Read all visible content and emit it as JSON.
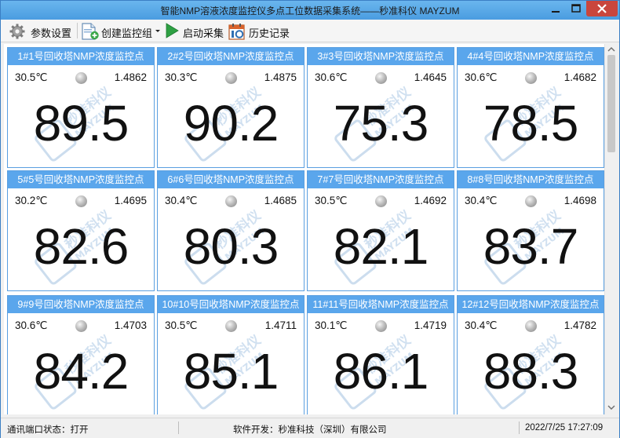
{
  "window": {
    "title": "智能NMP溶液浓度监控仪多点工位数据采集系统——秒准科仪 MAYZUM"
  },
  "toolbar": {
    "settings_label": "参数设置",
    "create_group_label": "创建监控组",
    "start_label": "启动采集",
    "history_label": "历史记录"
  },
  "watermark": {
    "brand_cn": "秒准科仪",
    "brand_en": "MAYZUM"
  },
  "cards": [
    {
      "title": "1#1号回收塔NMP浓度监控点",
      "temp": "30.5℃",
      "ref": "1.4862",
      "value": "89.5"
    },
    {
      "title": "2#2号回收塔NMP浓度监控点",
      "temp": "30.3℃",
      "ref": "1.4875",
      "value": "90.2"
    },
    {
      "title": "3#3号回收塔NMP浓度监控点",
      "temp": "30.6℃",
      "ref": "1.4645",
      "value": "75.3"
    },
    {
      "title": "4#4号回收塔NMP浓度监控点",
      "temp": "30.6℃",
      "ref": "1.4682",
      "value": "78.5"
    },
    {
      "title": "5#5号回收塔NMP浓度监控点",
      "temp": "30.2℃",
      "ref": "1.4695",
      "value": "82.6"
    },
    {
      "title": "6#6号回收塔NMP浓度监控点",
      "temp": "30.4℃",
      "ref": "1.4685",
      "value": "80.3"
    },
    {
      "title": "7#7号回收塔NMP浓度监控点",
      "temp": "30.5℃",
      "ref": "1.4692",
      "value": "82.1"
    },
    {
      "title": "8#8号回收塔NMP浓度监控点",
      "temp": "30.4℃",
      "ref": "1.4698",
      "value": "83.7"
    },
    {
      "title": "9#9号回收塔NMP浓度监控点",
      "temp": "30.6℃",
      "ref": "1.4703",
      "value": "84.2"
    },
    {
      "title": "10#10号回收塔NMP浓度监控点",
      "temp": "30.5℃",
      "ref": "1.4711",
      "value": "85.1"
    },
    {
      "title": "11#11号回收塔NMP浓度监控点",
      "temp": "30.1℃",
      "ref": "1.4719",
      "value": "86.1"
    },
    {
      "title": "12#12号回收塔NMP浓度监控点",
      "temp": "30.4℃",
      "ref": "1.4782",
      "value": "88.3"
    }
  ],
  "status": {
    "port": "通讯端口状态：打开",
    "developer": "软件开发：秒准科技（深圳）有限公司",
    "datetime": "2022/7/25 17:27:09"
  },
  "colors": {
    "card_header": "#5aa6ec",
    "card_border": "#5a9fe0",
    "led_gray": "#a8a8a8",
    "start_green": "#2ea043"
  }
}
